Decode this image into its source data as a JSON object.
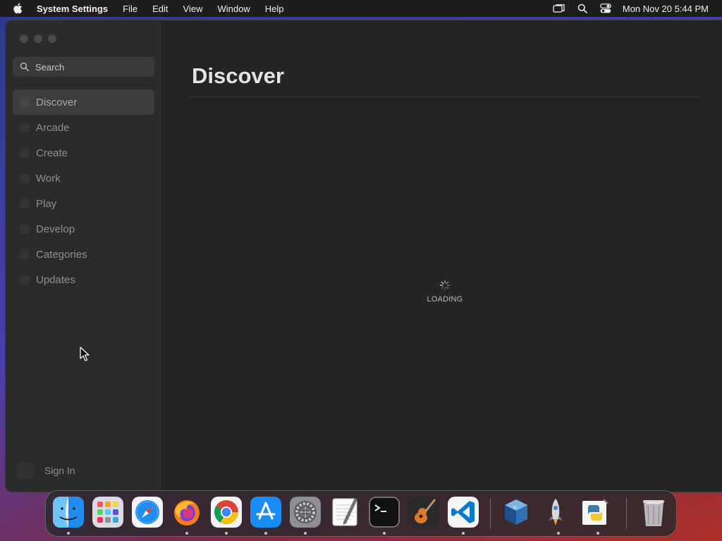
{
  "menubar": {
    "apple_icon": "apple-icon",
    "app_name": "System Settings",
    "menus": [
      "File",
      "Edit",
      "View",
      "Window",
      "Help"
    ],
    "status_icons": [
      "screen-mirroring-icon",
      "spotlight-search-icon",
      "control-center-icon"
    ],
    "clock": "Mon Nov 20  5:44 PM"
  },
  "sidebar": {
    "search_placeholder": "Search",
    "items": [
      {
        "label": "Discover",
        "active": true
      },
      {
        "label": "Arcade",
        "active": false
      },
      {
        "label": "Create",
        "active": false
      },
      {
        "label": "Work",
        "active": false
      },
      {
        "label": "Play",
        "active": false
      },
      {
        "label": "Develop",
        "active": false
      },
      {
        "label": "Categories",
        "active": false
      },
      {
        "label": "Updates",
        "active": false
      }
    ],
    "account_label": "Sign In"
  },
  "content": {
    "title": "Discover",
    "loading_text": "LOADING"
  },
  "dock": {
    "apps": [
      {
        "name": "finder-icon",
        "running": true
      },
      {
        "name": "launchpad-icon",
        "running": false
      },
      {
        "name": "safari-icon",
        "running": false
      },
      {
        "name": "firefox-icon",
        "running": true
      },
      {
        "name": "chrome-icon",
        "running": true
      },
      {
        "name": "app-store-icon",
        "running": true
      },
      {
        "name": "system-settings-icon",
        "running": true
      },
      {
        "name": "textedit-icon",
        "running": false
      },
      {
        "name": "terminal-icon",
        "running": true
      },
      {
        "name": "garageband-icon",
        "running": false
      },
      {
        "name": "vscode-icon",
        "running": true
      },
      {
        "name": "virtualbox-icon",
        "running": false
      },
      {
        "name": "rocket-app-icon",
        "running": true
      },
      {
        "name": "python-launcher-icon",
        "running": true
      },
      {
        "name": "trash-icon",
        "running": false
      }
    ]
  },
  "colors": {
    "window_bg": "#252525",
    "sidebar_bg": "#2b2b2b",
    "selected_item_bg": "#3d3d3d",
    "muted_text": "#8e8e8e"
  }
}
